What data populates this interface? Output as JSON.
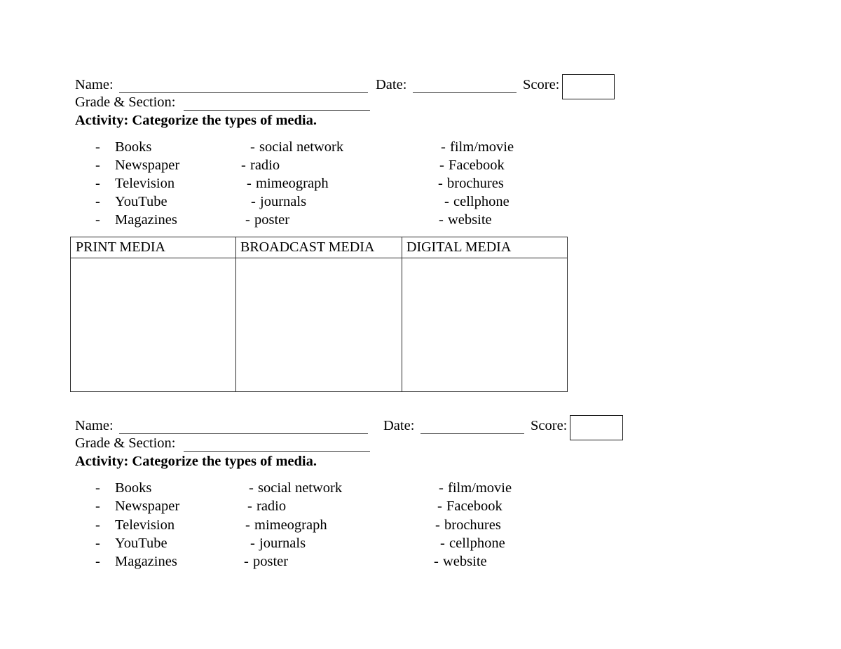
{
  "document": {
    "title": "Categorize the Types of Media Worksheet",
    "page_background": "#ffffff",
    "text_color": "#000000",
    "rule_color": "#3a3a3a",
    "border_color": "#2b2b2b"
  },
  "forms": [
    {
      "id": "form-top",
      "header": {
        "name_label": "Name:",
        "date_label": "Date:",
        "score_label": "Score:",
        "grade_section_label": "Grade & Section:",
        "name_value": "",
        "date_value": "",
        "score_value": "",
        "grade_section_value": ""
      },
      "activity": "Activity: Categorize the types of media.",
      "wordbank": {
        "column1": [
          "Books",
          "Newspaper",
          "Television",
          "YouTube",
          "Magazines"
        ],
        "column2": [
          "social network",
          "radio",
          "mimeograph",
          "journals",
          "poster"
        ],
        "column3": [
          "film/movie",
          "Facebook",
          "brochures",
          "cellphone",
          "website"
        ],
        "bullet": "-"
      },
      "table": {
        "headers": [
          "PRINT MEDIA",
          "BROADCAST MEDIA",
          "DIGITAL MEDIA"
        ],
        "rows": [
          [
            "",
            "",
            ""
          ]
        ]
      }
    },
    {
      "id": "form-bottom",
      "header": {
        "name_label": "Name:",
        "date_label": "Date:",
        "score_label": "Score:",
        "grade_section_label": "Grade & Section:",
        "name_value": "",
        "date_value": "",
        "score_value": "",
        "grade_section_value": ""
      },
      "activity": "Activity: Categorize the types of media.",
      "wordbank": {
        "column1": [
          "Books",
          "Newspaper",
          "Television",
          "YouTube",
          "Magazines"
        ],
        "column2": [
          "social network",
          "radio",
          "mimeograph",
          "journals",
          "poster"
        ],
        "column3": [
          "film/movie",
          "Facebook",
          "brochures",
          "cellphone",
          "website"
        ],
        "bullet": "-"
      }
    }
  ]
}
